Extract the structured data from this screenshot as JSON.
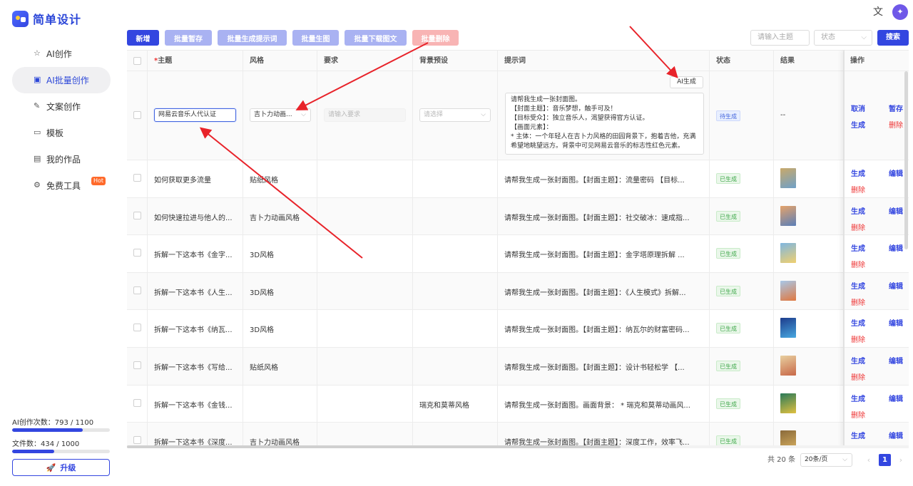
{
  "app": {
    "title": "简单设计"
  },
  "nav": [
    {
      "label": "AI创作",
      "icon": "star-icon",
      "glyph": "☆"
    },
    {
      "label": "AI批量创作",
      "icon": "image-icon",
      "glyph": "▣",
      "active": true
    },
    {
      "label": "文案创作",
      "icon": "edit-icon",
      "glyph": "✎"
    },
    {
      "label": "模板",
      "icon": "template-icon",
      "glyph": "▭"
    },
    {
      "label": "我的作品",
      "icon": "folder-icon",
      "glyph": "▤"
    },
    {
      "label": "免费工具",
      "icon": "gear-icon",
      "glyph": "⚙",
      "badge": "Hot"
    }
  ],
  "quota": {
    "ai_label": "AI创作次数：793 / 1100",
    "ai_used": 793,
    "ai_total": 1100,
    "file_label": "文件数：434 / 1000",
    "file_used": 434,
    "file_total": 1000
  },
  "upgrade_label": "升级",
  "toolbar": {
    "new": "新增",
    "batch_save": "批量暂存",
    "batch_prompt": "批量生成提示词",
    "batch_image": "批量生图",
    "batch_download": "批量下载图文",
    "batch_delete": "批量删除"
  },
  "filters": {
    "search_placeholder": "请输入主题",
    "status_placeholder": "状态",
    "search_button": "搜索"
  },
  "columns": {
    "topic": "主题",
    "style": "风格",
    "requirement": "要求",
    "background": "背景预设",
    "prompt": "提示词",
    "status": "状态",
    "result": "结果",
    "actions": "操作"
  },
  "editing_row": {
    "topic": "网易云音乐人代认证",
    "style": "吉卜力动画...",
    "requirement_placeholder": "请输入要求",
    "background_placeholder": "请选择",
    "ai_button": "AI生成",
    "prompt_lines": [
      "请帮我生成一张封面图。",
      "【封面主题】：音乐梦想，触手可及！",
      "【目标受众】：独立音乐人，渴望获得官方认证。",
      "【画面元素】：",
      "*  主体：一个年轻人在吉卜力风格的田园背景下，抱着吉他，充满",
      "希望地眺望远方。背景中可见网易云音乐的标志性红色元素。"
    ],
    "status": "待生成",
    "result": "--",
    "actions": {
      "cancel": "取消",
      "save": "暂存",
      "generate": "生成",
      "delete": "删除"
    }
  },
  "rows": [
    {
      "topic": "如何获取更多流量",
      "style": "贴纸风格",
      "background": "",
      "prompt": "请帮我生成一张封面图。【封面主题】：流量密码 【目标...",
      "status": "已生成",
      "thumb": [
        "#c9a96a",
        "#6fa0c8"
      ]
    },
    {
      "topic": "如何快速拉进与他人的...",
      "style": "吉卜力动画风格",
      "background": "",
      "prompt": "请帮我生成一张封面图。【封面主题】：社交破冰：速成指...",
      "status": "已生成",
      "thumb": [
        "#e5a36b",
        "#5b7fb8"
      ]
    },
    {
      "topic": "拆解一下这本书《金字...",
      "style": "3D风格",
      "background": "",
      "prompt": "请帮我生成一张封面图。【封面主题】：金字塔原理拆解 ...",
      "status": "已生成",
      "thumb": [
        "#7fb6e0",
        "#f0d070"
      ]
    },
    {
      "topic": "拆解一下这本书《人生...",
      "style": "3D风格",
      "background": "",
      "prompt": "请帮我生成一张封面图。【封面主题】：《人生模式》拆解...",
      "status": "已生成",
      "thumb": [
        "#a8c8e8",
        "#e07840"
      ]
    },
    {
      "topic": "拆解一下这本书《纳瓦...",
      "style": "3D风格",
      "background": "",
      "prompt": "请帮我生成一张封面图。【封面主题】：纳瓦尔的财富密码...",
      "status": "已生成",
      "thumb": [
        "#1d3c8c",
        "#48a8e0"
      ]
    },
    {
      "topic": "拆解一下这本书《写给...",
      "style": "贴纸风格",
      "background": "",
      "prompt": "请帮我生成一张封面图。【封面主题】：设计书轻松学 【...",
      "status": "已生成",
      "thumb": [
        "#e8d0a0",
        "#c86848"
      ]
    },
    {
      "topic": "拆解一下这本书《金钱...",
      "style": "",
      "background": "瑞克和莫蒂风格",
      "prompt": "请帮我生成一张封面图。画面背景： * 瑞克和莫蒂动画风...",
      "status": "已生成",
      "thumb": [
        "#2a7a5a",
        "#e0c040"
      ]
    },
    {
      "topic": "拆解一下这本书《深度...",
      "style": "吉卜力动画风格",
      "background": "",
      "prompt": "请帮我生成一张封面图。【封面主题】：深度工作，效率飞...",
      "status": "已生成",
      "thumb": [
        "#8a6a3a",
        "#d8b060"
      ]
    }
  ],
  "row_actions": {
    "generate": "生成",
    "edit": "编辑",
    "delete": "删除"
  },
  "pagination": {
    "total": "共 20 条",
    "page_size": "20条/页",
    "current": "1",
    "prev": "‹",
    "next": "›"
  }
}
